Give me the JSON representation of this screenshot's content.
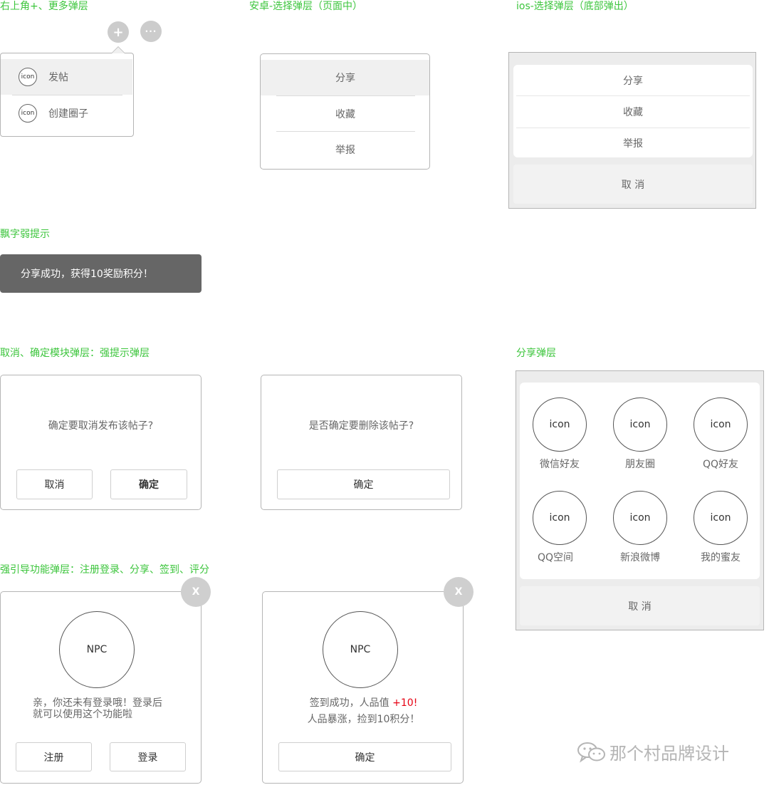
{
  "sections": {
    "top_right_menu": "右上角+、更多弹层",
    "android_sheet": "安卓-选择弹层（页面中）",
    "ios_sheet": "ios-选择弹层（底部弹出）",
    "toast": "飘字弱提示",
    "confirm_dialogs": "取消、确定模块弹层：强提示弹层",
    "share_sheet": "分享弹层",
    "guide_dialogs": "强引导功能弹层：注册登录、分享、签到、评分"
  },
  "top_menu": {
    "plus_glyph": "+",
    "more_glyph": "···",
    "items": [
      {
        "icon": "icon",
        "label": "发帖"
      },
      {
        "icon": "icon",
        "label": "创建圈子"
      }
    ]
  },
  "android": {
    "items": [
      "分享",
      "收藏",
      "举报"
    ]
  },
  "ios": {
    "items": [
      "分享",
      "收藏",
      "举报"
    ],
    "cancel": "取 消"
  },
  "toast": {
    "text": "分享成功，获得10奖励积分！"
  },
  "dialog_cancel_publish": {
    "message": "确定要取消发布该帖子?",
    "cancel": "取消",
    "confirm": "确定"
  },
  "dialog_delete": {
    "message": "是否确定要删除该帖子?",
    "confirm": "确定"
  },
  "share": {
    "items": [
      {
        "icon": "icon",
        "label": "微信好友"
      },
      {
        "icon": "icon",
        "label": "朋友圈"
      },
      {
        "icon": "icon",
        "label": "QQ好友"
      },
      {
        "icon": "icon",
        "label": "QQ空间"
      },
      {
        "icon": "icon",
        "label": "新浪微博"
      },
      {
        "icon": "icon",
        "label": "我的蜜友"
      }
    ],
    "cancel": "取 消"
  },
  "guide_login": {
    "close": "X",
    "npc": "NPC",
    "line1": "亲，你还未有登录哦！登录后",
    "line2": "就可以使用这个功能啦",
    "register": "注册",
    "login": "登录"
  },
  "guide_checkin": {
    "close": "X",
    "npc": "NPC",
    "line1_prefix": "签到成功，人品值 ",
    "line1_highlight": "+10",
    "line1_suffix": "!",
    "line2": "人品暴涨，捡到10积分！",
    "confirm": "确定"
  },
  "watermark": {
    "text": "那个村品牌设计"
  },
  "colors": {
    "section_label": "#3cc53c",
    "highlight": "#e60012",
    "toast_bg": "#666666",
    "frame_bg": "#ececec"
  }
}
